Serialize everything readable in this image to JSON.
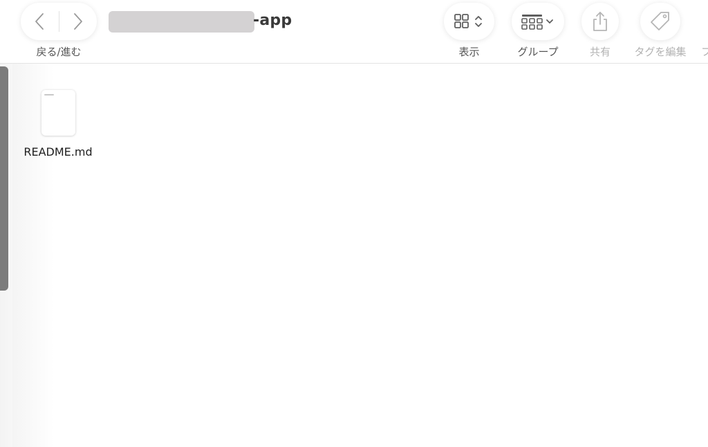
{
  "window": {
    "title_suffix": "-app"
  },
  "toolbar": {
    "nav_label": "戻る/進む",
    "back_icon": "chevron-left-icon",
    "forward_icon": "chevron-right-icon",
    "view": {
      "label": "表示",
      "icon": "grid-view-icon"
    },
    "group": {
      "label": "グループ",
      "icon": "group-icon"
    },
    "share": {
      "label": "共有",
      "icon": "share-icon",
      "enabled": false
    },
    "tag": {
      "label": "タグを編集",
      "icon": "tag-icon",
      "enabled": false
    },
    "cut_label": "フ"
  },
  "files": [
    {
      "name": "README.md",
      "icon": "document-icon"
    }
  ],
  "colors": {
    "icon": "#5e5e5e",
    "icon_disabled": "#b5b5b5",
    "redaction": "#d4d2d3",
    "scrollbar": "#7c7c7c"
  }
}
